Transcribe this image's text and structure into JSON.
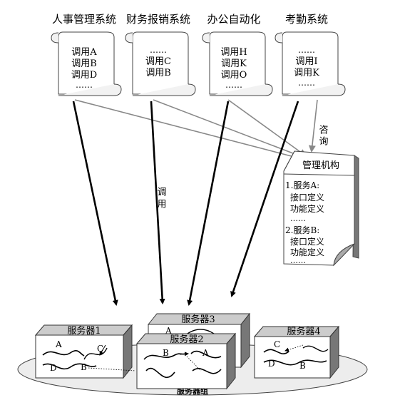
{
  "systems": [
    {
      "title": "人事管理系统",
      "lines": [
        "调用A",
        "调用B",
        "调用D",
        "……"
      ]
    },
    {
      "title": "财务报销系统",
      "lines": [
        "……",
        "调用C",
        "调用B",
        ""
      ]
    },
    {
      "title": "办公自动化",
      "lines": [
        "调用H",
        "调用K",
        "调用O",
        "……"
      ]
    },
    {
      "title": "考勤系统",
      "lines": [
        "……",
        "调用I",
        "调用K",
        "……"
      ]
    }
  ],
  "labels": {
    "call": "调用",
    "query": "咨询"
  },
  "registry": {
    "title": "管理机构",
    "lines": [
      "1.服务A:",
      "接口定义",
      "功能定义",
      "……",
      "2.服务B:",
      "接口定义",
      "功能定义",
      "……"
    ]
  },
  "servers": [
    {
      "title": "服务器1",
      "letters": [
        "A",
        "C",
        "D",
        "B"
      ]
    },
    {
      "title": "服务器2",
      "letters": [
        "B",
        "A"
      ]
    },
    {
      "title": "服务器3",
      "letters": [
        "A"
      ]
    },
    {
      "title": "服务器4",
      "letters": [
        "C",
        "D",
        "B"
      ]
    }
  ],
  "cluster_label": "服务器组"
}
